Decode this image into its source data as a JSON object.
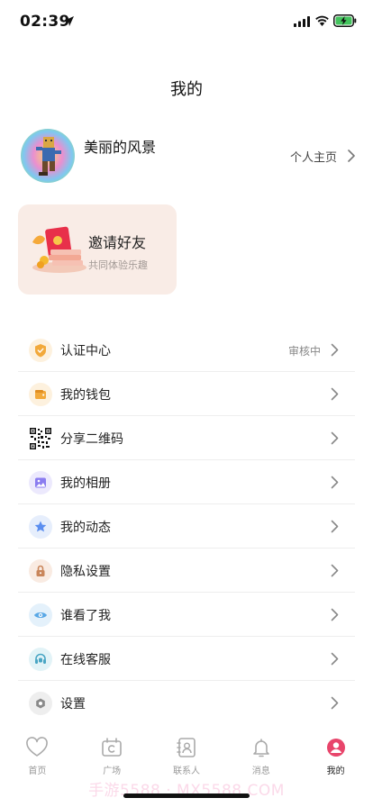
{
  "status_bar": {
    "time": "02:39"
  },
  "header": {
    "title": "我的"
  },
  "profile": {
    "nickname": "美丽的风景",
    "homepage_label": "个人主页"
  },
  "invite": {
    "title": "邀请好友",
    "subtitle": "共同体验乐趣"
  },
  "menu": [
    {
      "label": "认证中心",
      "status": "审核中",
      "icon": "certification-shield-icon",
      "color": "#f2a93b"
    },
    {
      "label": "我的钱包",
      "status": "",
      "icon": "wallet-icon",
      "color": "#f2a93b"
    },
    {
      "label": "分享二维码",
      "status": "",
      "icon": "qr-code-icon",
      "color": "#000000"
    },
    {
      "label": "我的相册",
      "status": "",
      "icon": "album-icon",
      "color": "#8a7cf0"
    },
    {
      "label": "我的动态",
      "status": "",
      "icon": "star-icon",
      "color": "#5b8ef0"
    },
    {
      "label": "隐私设置",
      "status": "",
      "icon": "lock-icon",
      "color": "#c9855a"
    },
    {
      "label": "谁看了我",
      "status": "",
      "icon": "eye-icon",
      "color": "#5aa8e6"
    },
    {
      "label": "在线客服",
      "status": "",
      "icon": "headset-icon",
      "color": "#4aa6c4"
    },
    {
      "label": "设置",
      "status": "",
      "icon": "gear-icon",
      "color": "#8a8a8a"
    }
  ],
  "tabs": [
    {
      "label": "首页",
      "icon": "heart-icon",
      "active": false
    },
    {
      "label": "广场",
      "icon": "square-icon",
      "active": false
    },
    {
      "label": "联系人",
      "icon": "contacts-icon",
      "active": false
    },
    {
      "label": "消息",
      "icon": "bell-icon",
      "active": false
    },
    {
      "label": "我的",
      "icon": "profile-icon",
      "active": true
    }
  ],
  "watermark": "手游5588 · MX5588.COM",
  "colors": {
    "accent": "#e8456b",
    "card_bg": "#f9ece6",
    "divider": "#eeeeee"
  }
}
